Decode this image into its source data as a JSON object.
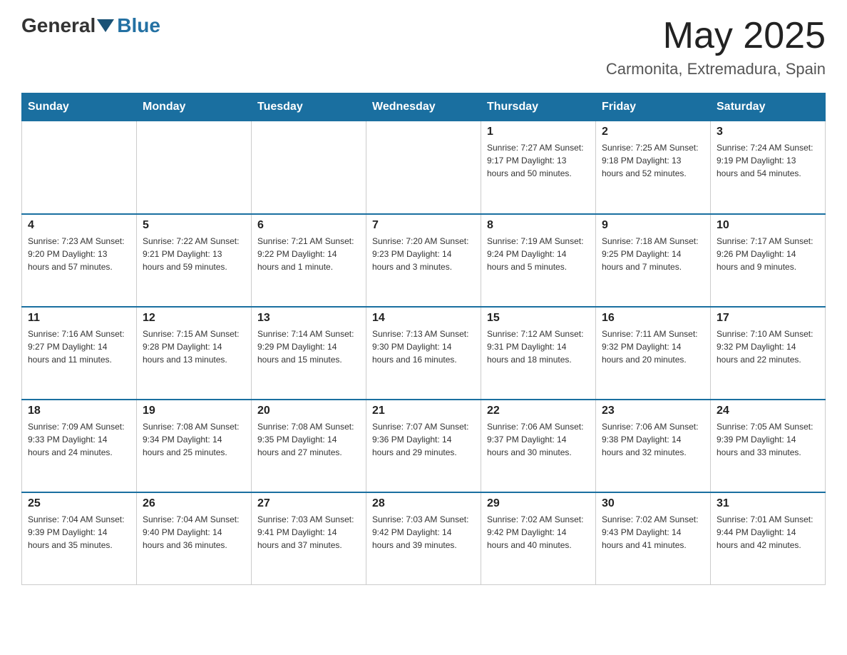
{
  "header": {
    "logo": {
      "part1": "General",
      "part2": "Blue"
    },
    "title": "May 2025",
    "location": "Carmonita, Extremadura, Spain"
  },
  "days_of_week": [
    "Sunday",
    "Monday",
    "Tuesday",
    "Wednesday",
    "Thursday",
    "Friday",
    "Saturday"
  ],
  "weeks": [
    [
      {
        "day": "",
        "info": ""
      },
      {
        "day": "",
        "info": ""
      },
      {
        "day": "",
        "info": ""
      },
      {
        "day": "",
        "info": ""
      },
      {
        "day": "1",
        "info": "Sunrise: 7:27 AM\nSunset: 9:17 PM\nDaylight: 13 hours and 50 minutes."
      },
      {
        "day": "2",
        "info": "Sunrise: 7:25 AM\nSunset: 9:18 PM\nDaylight: 13 hours and 52 minutes."
      },
      {
        "day": "3",
        "info": "Sunrise: 7:24 AM\nSunset: 9:19 PM\nDaylight: 13 hours and 54 minutes."
      }
    ],
    [
      {
        "day": "4",
        "info": "Sunrise: 7:23 AM\nSunset: 9:20 PM\nDaylight: 13 hours and 57 minutes."
      },
      {
        "day": "5",
        "info": "Sunrise: 7:22 AM\nSunset: 9:21 PM\nDaylight: 13 hours and 59 minutes."
      },
      {
        "day": "6",
        "info": "Sunrise: 7:21 AM\nSunset: 9:22 PM\nDaylight: 14 hours and 1 minute."
      },
      {
        "day": "7",
        "info": "Sunrise: 7:20 AM\nSunset: 9:23 PM\nDaylight: 14 hours and 3 minutes."
      },
      {
        "day": "8",
        "info": "Sunrise: 7:19 AM\nSunset: 9:24 PM\nDaylight: 14 hours and 5 minutes."
      },
      {
        "day": "9",
        "info": "Sunrise: 7:18 AM\nSunset: 9:25 PM\nDaylight: 14 hours and 7 minutes."
      },
      {
        "day": "10",
        "info": "Sunrise: 7:17 AM\nSunset: 9:26 PM\nDaylight: 14 hours and 9 minutes."
      }
    ],
    [
      {
        "day": "11",
        "info": "Sunrise: 7:16 AM\nSunset: 9:27 PM\nDaylight: 14 hours and 11 minutes."
      },
      {
        "day": "12",
        "info": "Sunrise: 7:15 AM\nSunset: 9:28 PM\nDaylight: 14 hours and 13 minutes."
      },
      {
        "day": "13",
        "info": "Sunrise: 7:14 AM\nSunset: 9:29 PM\nDaylight: 14 hours and 15 minutes."
      },
      {
        "day": "14",
        "info": "Sunrise: 7:13 AM\nSunset: 9:30 PM\nDaylight: 14 hours and 16 minutes."
      },
      {
        "day": "15",
        "info": "Sunrise: 7:12 AM\nSunset: 9:31 PM\nDaylight: 14 hours and 18 minutes."
      },
      {
        "day": "16",
        "info": "Sunrise: 7:11 AM\nSunset: 9:32 PM\nDaylight: 14 hours and 20 minutes."
      },
      {
        "day": "17",
        "info": "Sunrise: 7:10 AM\nSunset: 9:32 PM\nDaylight: 14 hours and 22 minutes."
      }
    ],
    [
      {
        "day": "18",
        "info": "Sunrise: 7:09 AM\nSunset: 9:33 PM\nDaylight: 14 hours and 24 minutes."
      },
      {
        "day": "19",
        "info": "Sunrise: 7:08 AM\nSunset: 9:34 PM\nDaylight: 14 hours and 25 minutes."
      },
      {
        "day": "20",
        "info": "Sunrise: 7:08 AM\nSunset: 9:35 PM\nDaylight: 14 hours and 27 minutes."
      },
      {
        "day": "21",
        "info": "Sunrise: 7:07 AM\nSunset: 9:36 PM\nDaylight: 14 hours and 29 minutes."
      },
      {
        "day": "22",
        "info": "Sunrise: 7:06 AM\nSunset: 9:37 PM\nDaylight: 14 hours and 30 minutes."
      },
      {
        "day": "23",
        "info": "Sunrise: 7:06 AM\nSunset: 9:38 PM\nDaylight: 14 hours and 32 minutes."
      },
      {
        "day": "24",
        "info": "Sunrise: 7:05 AM\nSunset: 9:39 PM\nDaylight: 14 hours and 33 minutes."
      }
    ],
    [
      {
        "day": "25",
        "info": "Sunrise: 7:04 AM\nSunset: 9:39 PM\nDaylight: 14 hours and 35 minutes."
      },
      {
        "day": "26",
        "info": "Sunrise: 7:04 AM\nSunset: 9:40 PM\nDaylight: 14 hours and 36 minutes."
      },
      {
        "day": "27",
        "info": "Sunrise: 7:03 AM\nSunset: 9:41 PM\nDaylight: 14 hours and 37 minutes."
      },
      {
        "day": "28",
        "info": "Sunrise: 7:03 AM\nSunset: 9:42 PM\nDaylight: 14 hours and 39 minutes."
      },
      {
        "day": "29",
        "info": "Sunrise: 7:02 AM\nSunset: 9:42 PM\nDaylight: 14 hours and 40 minutes."
      },
      {
        "day": "30",
        "info": "Sunrise: 7:02 AM\nSunset: 9:43 PM\nDaylight: 14 hours and 41 minutes."
      },
      {
        "day": "31",
        "info": "Sunrise: 7:01 AM\nSunset: 9:44 PM\nDaylight: 14 hours and 42 minutes."
      }
    ]
  ]
}
